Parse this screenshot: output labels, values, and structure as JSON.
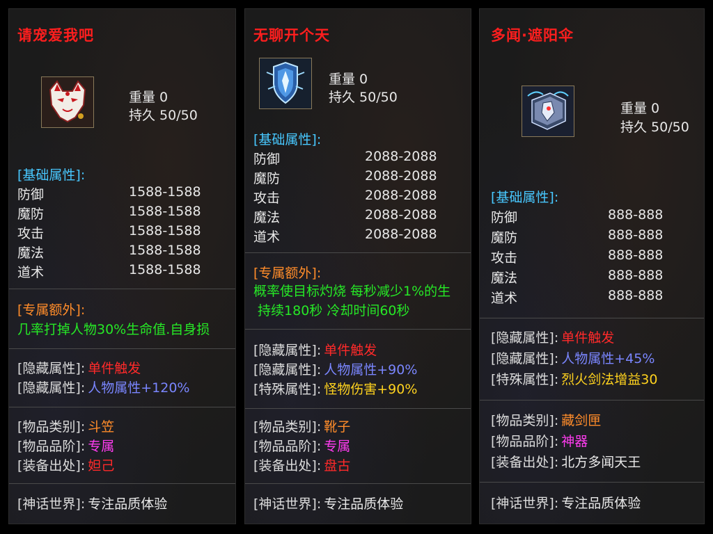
{
  "panels": [
    {
      "title": "请宠爱我吧",
      "icon": "fox-mask-icon",
      "weight": "重量 0",
      "durability": "持久 50/50",
      "base_header": "[基础属性]:",
      "stats": [
        {
          "label": "防御",
          "value": "1588-1588"
        },
        {
          "label": "魔防",
          "value": "1588-1588"
        },
        {
          "label": "攻击",
          "value": "1588-1588"
        },
        {
          "label": "魔法",
          "value": "1588-1588"
        },
        {
          "label": "道术",
          "value": "1588-1588"
        }
      ],
      "extra_header": "[专属额外]:",
      "extra_lines": [
        "几率打掉人物30%生命值.自身损"
      ],
      "hidden": [
        {
          "label": "[隐藏属性]:",
          "value": "单件触发",
          "color": "#ff2a2a"
        },
        {
          "label": "[隐藏属性]:",
          "value": "人物属性+120%",
          "color": "#7a86ff"
        }
      ],
      "item": [
        {
          "label": "[物品类别]:",
          "value": "斗笠",
          "color": "#ff8c2a"
        },
        {
          "label": "[物品品阶]:",
          "value": "专属",
          "color": "#ff3cf0"
        },
        {
          "label": "[装备出处]:",
          "value": "妲己",
          "color": "#ff2a2a"
        }
      ],
      "footer": {
        "label": "[神话世界]:",
        "value": "专注品质体验"
      }
    },
    {
      "title": "无聊开个天",
      "icon": "crystal-shield-icon",
      "weight": "重量 0",
      "durability": "持久 50/50",
      "base_header": "[基础属性]:",
      "stats": [
        {
          "label": "防御",
          "value": "2088-2088"
        },
        {
          "label": "魔防",
          "value": "2088-2088"
        },
        {
          "label": "攻击",
          "value": "2088-2088"
        },
        {
          "label": "魔法",
          "value": "2088-2088"
        },
        {
          "label": "道术",
          "value": "2088-2088"
        }
      ],
      "extra_header": "[专属额外]:",
      "extra_lines": [
        "概率使目标灼烧 每秒减少1%的生",
        " 持续180秒 冷却时间60秒"
      ],
      "hidden": [
        {
          "label": "[隐藏属性]:",
          "value": "单件触发",
          "color": "#ff2a2a"
        },
        {
          "label": "[隐藏属性]:",
          "value": "人物属性+90%",
          "color": "#7a86ff"
        },
        {
          "label": "[特殊属性]:",
          "value": "怪物伤害+90%",
          "color": "#ffd21e"
        }
      ],
      "item": [
        {
          "label": "[物品类别]:",
          "value": "靴子",
          "color": "#ff8c2a"
        },
        {
          "label": "[物品品阶]:",
          "value": "专属",
          "color": "#ff3cf0"
        },
        {
          "label": "[装备出处]:",
          "value": "盘古",
          "color": "#ff2a2a"
        }
      ],
      "footer": {
        "label": "[神话世界]:",
        "value": "专注品质体验"
      }
    },
    {
      "title": "多闻·遮阳伞",
      "icon": "armor-book-icon",
      "weight": "重量 0",
      "durability": "持久 50/50",
      "base_header": "[基础属性]:",
      "stats": [
        {
          "label": "防御",
          "value": "888-888"
        },
        {
          "label": "魔防",
          "value": "888-888"
        },
        {
          "label": "攻击",
          "value": "888-888"
        },
        {
          "label": "魔法",
          "value": "888-888"
        },
        {
          "label": "道术",
          "value": "888-888"
        }
      ],
      "hidden": [
        {
          "label": "[隐藏属性]:",
          "value": "单件触发",
          "color": "#ff2a2a"
        },
        {
          "label": "[隐藏属性]:",
          "value": "人物属性+45%",
          "color": "#7a86ff"
        },
        {
          "label": "[特殊属性]:",
          "value": "烈火剑法增益30",
          "color": "#ffd21e"
        }
      ],
      "item": [
        {
          "label": "[物品类别]:",
          "value": "藏剑匣",
          "color": "#ff8c2a"
        },
        {
          "label": "[物品品阶]:",
          "value": "神器",
          "color": "#ff3cf0"
        },
        {
          "label": "[装备出处]:",
          "value": "北方多闻天王",
          "color": "#e8e8e8"
        }
      ],
      "footer": {
        "label": "[神话世界]:",
        "value": "专注品质体验"
      }
    }
  ]
}
